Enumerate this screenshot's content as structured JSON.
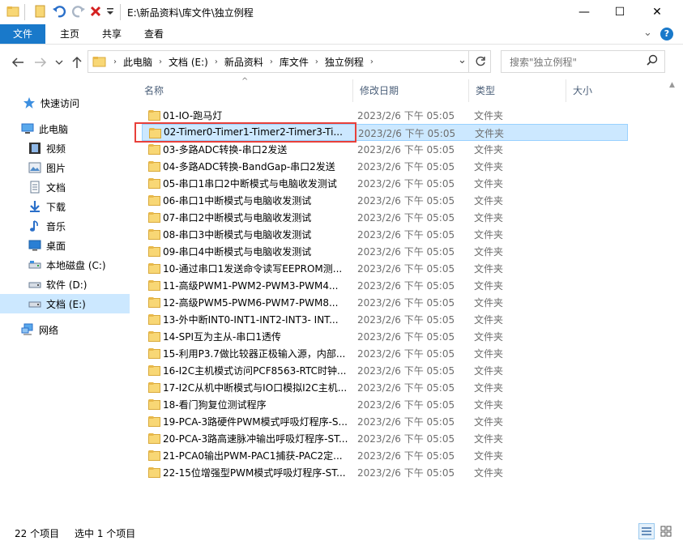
{
  "window": {
    "title": "E:\\新品资料\\库文件\\独立例程",
    "minimize_glyph": "—",
    "maximize_glyph": "☐",
    "close_glyph": "✕"
  },
  "ribbon": {
    "tabs": [
      "文件",
      "主页",
      "共享",
      "查看"
    ],
    "collapse_glyph": "⌄",
    "help_glyph": "?"
  },
  "address": {
    "crumbs": [
      "此电脑",
      "文档 (E:)",
      "新品资料",
      "库文件",
      "独立例程"
    ],
    "chevron_glyph": "⌄"
  },
  "search": {
    "placeholder": "搜索\"独立例程\""
  },
  "sidebar": {
    "items": [
      {
        "label": "快速访问",
        "icon": "star-icon"
      },
      {
        "label": "此电脑",
        "icon": "computer-icon"
      },
      {
        "label": "视频",
        "icon": "video-icon"
      },
      {
        "label": "图片",
        "icon": "pictures-icon"
      },
      {
        "label": "文档",
        "icon": "documents-icon"
      },
      {
        "label": "下载",
        "icon": "download-icon"
      },
      {
        "label": "音乐",
        "icon": "music-icon"
      },
      {
        "label": "桌面",
        "icon": "desktop-icon"
      },
      {
        "label": "本地磁盘 (C:)",
        "icon": "drive-icon"
      },
      {
        "label": "软件 (D:)",
        "icon": "drive-icon"
      },
      {
        "label": "文档 (E:)",
        "icon": "drive-icon"
      },
      {
        "label": "网络",
        "icon": "network-icon"
      }
    ]
  },
  "columns": {
    "name": "名称",
    "date": "修改日期",
    "type": "类型",
    "size": "大小"
  },
  "files": [
    {
      "name": "01-IO-跑马灯",
      "date": "2023/2/6 下午 05:05",
      "type": "文件夹"
    },
    {
      "name": "02-Timer0-Timer1-Timer2-Timer3-Ti...",
      "date": "2023/2/6 下午 05:05",
      "type": "文件夹"
    },
    {
      "name": "03-多路ADC转换-串口2发送",
      "date": "2023/2/6 下午 05:05",
      "type": "文件夹"
    },
    {
      "name": "04-多路ADC转换-BandGap-串口2发送",
      "date": "2023/2/6 下午 05:05",
      "type": "文件夹"
    },
    {
      "name": "05-串口1串口2中断模式与电脑收发测试",
      "date": "2023/2/6 下午 05:05",
      "type": "文件夹"
    },
    {
      "name": "06-串口1中断模式与电脑收发测试",
      "date": "2023/2/6 下午 05:05",
      "type": "文件夹"
    },
    {
      "name": "07-串口2中断模式与电脑收发测试",
      "date": "2023/2/6 下午 05:05",
      "type": "文件夹"
    },
    {
      "name": "08-串口3中断模式与电脑收发测试",
      "date": "2023/2/6 下午 05:05",
      "type": "文件夹"
    },
    {
      "name": "09-串口4中断模式与电脑收发测试",
      "date": "2023/2/6 下午 05:05",
      "type": "文件夹"
    },
    {
      "name": "10-通过串口1发送命令读写EEPROM测...",
      "date": "2023/2/6 下午 05:05",
      "type": "文件夹"
    },
    {
      "name": "11-高级PWM1-PWM2-PWM3-PWM4...",
      "date": "2023/2/6 下午 05:05",
      "type": "文件夹"
    },
    {
      "name": "12-高级PWM5-PWM6-PWM7-PWM8...",
      "date": "2023/2/6 下午 05:05",
      "type": "文件夹"
    },
    {
      "name": "13-外中断INT0-INT1-INT2-INT3- INT...",
      "date": "2023/2/6 下午 05:05",
      "type": "文件夹"
    },
    {
      "name": "14-SPI互为主从-串口1透传",
      "date": "2023/2/6 下午 05:05",
      "type": "文件夹"
    },
    {
      "name": "15-利用P3.7做比较器正极输入源，内部...",
      "date": "2023/2/6 下午 05:05",
      "type": "文件夹"
    },
    {
      "name": "16-I2C主机模式访问PCF8563-RTC时钟...",
      "date": "2023/2/6 下午 05:05",
      "type": "文件夹"
    },
    {
      "name": "17-I2C从机中断模式与IO口模拟I2C主机...",
      "date": "2023/2/6 下午 05:05",
      "type": "文件夹"
    },
    {
      "name": "18-看门狗复位测试程序",
      "date": "2023/2/6 下午 05:05",
      "type": "文件夹"
    },
    {
      "name": "19-PCA-3路硬件PWM模式呼吸灯程序-S...",
      "date": "2023/2/6 下午 05:05",
      "type": "文件夹"
    },
    {
      "name": "20-PCA-3路高速脉冲输出呼吸灯程序-ST...",
      "date": "2023/2/6 下午 05:05",
      "type": "文件夹"
    },
    {
      "name": "21-PCA0输出PWM-PAC1捕获-PAC2定...",
      "date": "2023/2/6 下午 05:05",
      "type": "文件夹"
    },
    {
      "name": "22-15位增强型PWM模式呼吸灯程序-ST...",
      "date": "2023/2/6 下午 05:05",
      "type": "文件夹"
    }
  ],
  "status": {
    "count": "22 个项目",
    "selected": "选中 1 个项目"
  },
  "colors": {
    "accent": "#1979ca",
    "selection": "#cce8ff",
    "highlight_box": "#e8403a",
    "folder": "#f8d775"
  }
}
